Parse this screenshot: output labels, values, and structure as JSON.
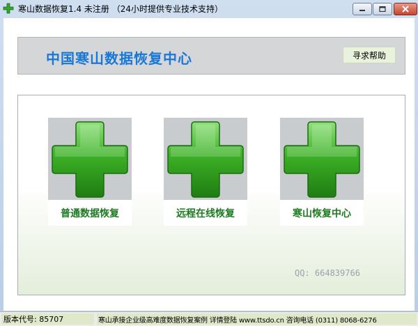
{
  "window": {
    "title": "寒山数据恢复1.4 未注册 （24小时提供专业技术支持）"
  },
  "header": {
    "title": "中国寒山数据恢复中心",
    "help_button": "寻求帮助"
  },
  "cards": [
    {
      "label": "普通数据恢复",
      "icon": "green-cross-icon"
    },
    {
      "label": "远程在线恢复",
      "icon": "green-cross-icon"
    },
    {
      "label": "寒山恢复中心",
      "icon": "green-cross-icon"
    }
  ],
  "qq": "QQ: 664839766",
  "status": {
    "version": "版本代号: 85707",
    "info": "寒山承接企业级高难度数据恢复案例 详情登陆 www.ttsdo.cn 咨询电话 (0311) 8068-6276"
  },
  "colors": {
    "title_blue": "#1878d8",
    "label_green": "#1d7a20",
    "cross_green": "#2f9e1f"
  }
}
